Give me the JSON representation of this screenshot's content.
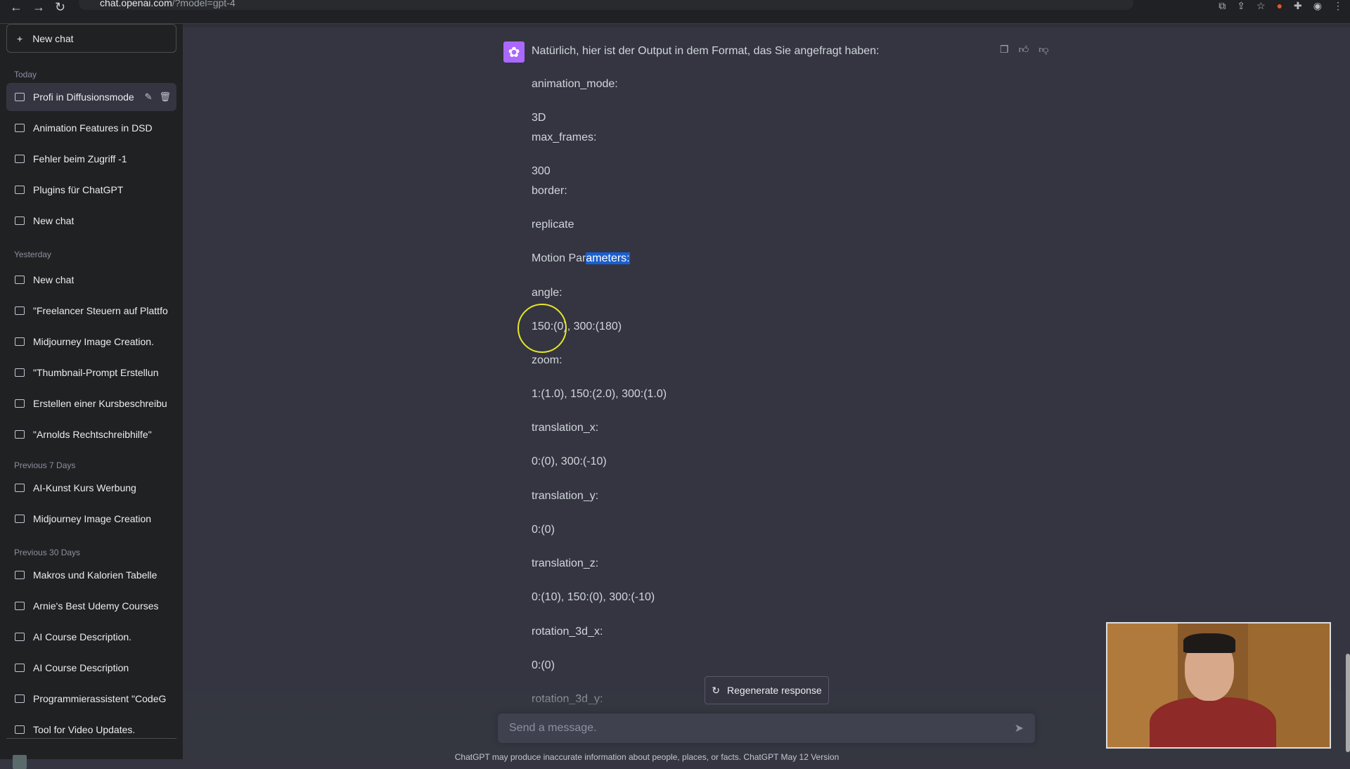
{
  "browser": {
    "url_host": "chat.openai.com",
    "url_rest": "/?model=gpt-4"
  },
  "sidebar": {
    "new_chat": "New chat",
    "sections": [
      {
        "label": "Today",
        "items": [
          "Profi in Diffusionsmode",
          "Animation Features in DSD",
          "Fehler beim Zugriff -1",
          "Plugins für ChatGPT",
          "New chat"
        ]
      },
      {
        "label": "Yesterday",
        "items": [
          "New chat",
          "\"Freelancer Steuern auf Plattfo",
          "Midjourney Image Creation.",
          "\"Thumbnail-Prompt Erstellun",
          "Erstellen einer Kursbeschreibu",
          "\"Arnolds Rechtschreibhilfe\""
        ]
      },
      {
        "label": "Previous 7 Days",
        "items": [
          "AI-Kunst Kurs Werbung",
          "Midjourney Image Creation"
        ]
      },
      {
        "label": "Previous 30 Days",
        "items": [
          "Makros und Kalorien Tabelle",
          "Arnie's Best Udemy Courses",
          "AI Course Description.",
          "AI Course Description",
          "Programmierassistent \"CodeG",
          "Tool for Video Updates."
        ]
      }
    ],
    "active_item": "Profi in Diffusionsmode"
  },
  "message": {
    "intro": "Natürlich, hier ist der Output in dem Format, das Sie angefragt haben:",
    "lines": [
      "animation_mode:",
      "3D",
      "max_frames:",
      "300",
      "border:",
      "replicate",
      "Motion Parameters:",
      "angle:",
      "150:(0), 300:(180)",
      "zoom:",
      "1:(1.0), 150:(2.0), 300:(1.0)",
      "translation_x:",
      "0:(0), 300:(-10)",
      "translation_y:",
      "0:(0)",
      "translation_z:",
      "0:(10), 150:(0), 300:(-10)",
      "rotation_3d_x:",
      "0:(0)",
      "rotation_3d_y:"
    ],
    "highlight": {
      "before": "Motion Par",
      "selected": "ameters:"
    }
  },
  "regenerate": "Regenerate response",
  "input": {
    "placeholder": "Send a message."
  },
  "footer": "ChatGPT may produce inaccurate information about people, places, or facts. ChatGPT May 12 Version",
  "colors": {
    "bg": "#343541",
    "sidebar": "#202123",
    "avatar": "#ab68ff",
    "highlight": "#1a5fcf"
  }
}
